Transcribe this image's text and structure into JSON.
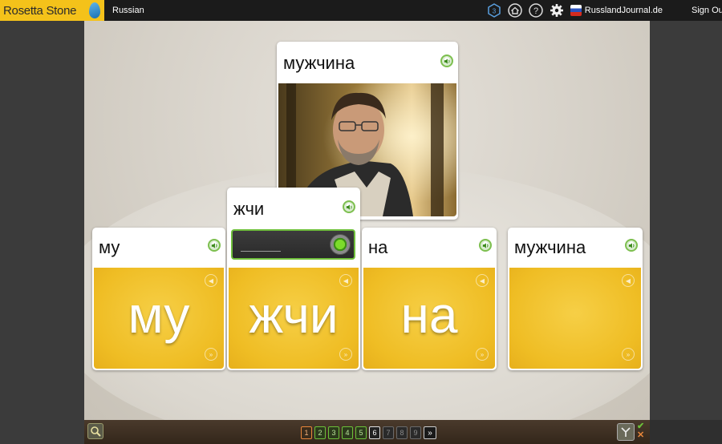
{
  "app": {
    "brand": "Rosetta Stone",
    "language": "Russian"
  },
  "topbar": {
    "level_badge": "3",
    "account_name": "RusslandJournal.de",
    "signout_label": "Sign Out"
  },
  "cards": {
    "prompt": {
      "word": "мужчина"
    },
    "syllables": [
      {
        "word": "му",
        "big": "му"
      },
      {
        "word": "жчи",
        "big": "жчи"
      },
      {
        "word": "на",
        "big": "на"
      },
      {
        "word": "мужчина",
        "big": ""
      }
    ]
  },
  "pager": {
    "pages": [
      "1",
      "2",
      "3",
      "4",
      "5",
      "6",
      "7",
      "8",
      "9"
    ],
    "current": "6",
    "next_glyph": "»"
  },
  "marks": {
    "ok": "✔",
    "x": "✕"
  },
  "colors": {
    "accent_yellow": "#f4c21a",
    "card_yellow": "#efbd24",
    "ok_green": "#6cc03a",
    "visited_orange": "#e8863a"
  },
  "icons": [
    "level-badge-icon",
    "home-icon",
    "help-icon",
    "gear-icon",
    "speaker-icon",
    "mic-icon",
    "magnifier-icon",
    "next-icon"
  ]
}
